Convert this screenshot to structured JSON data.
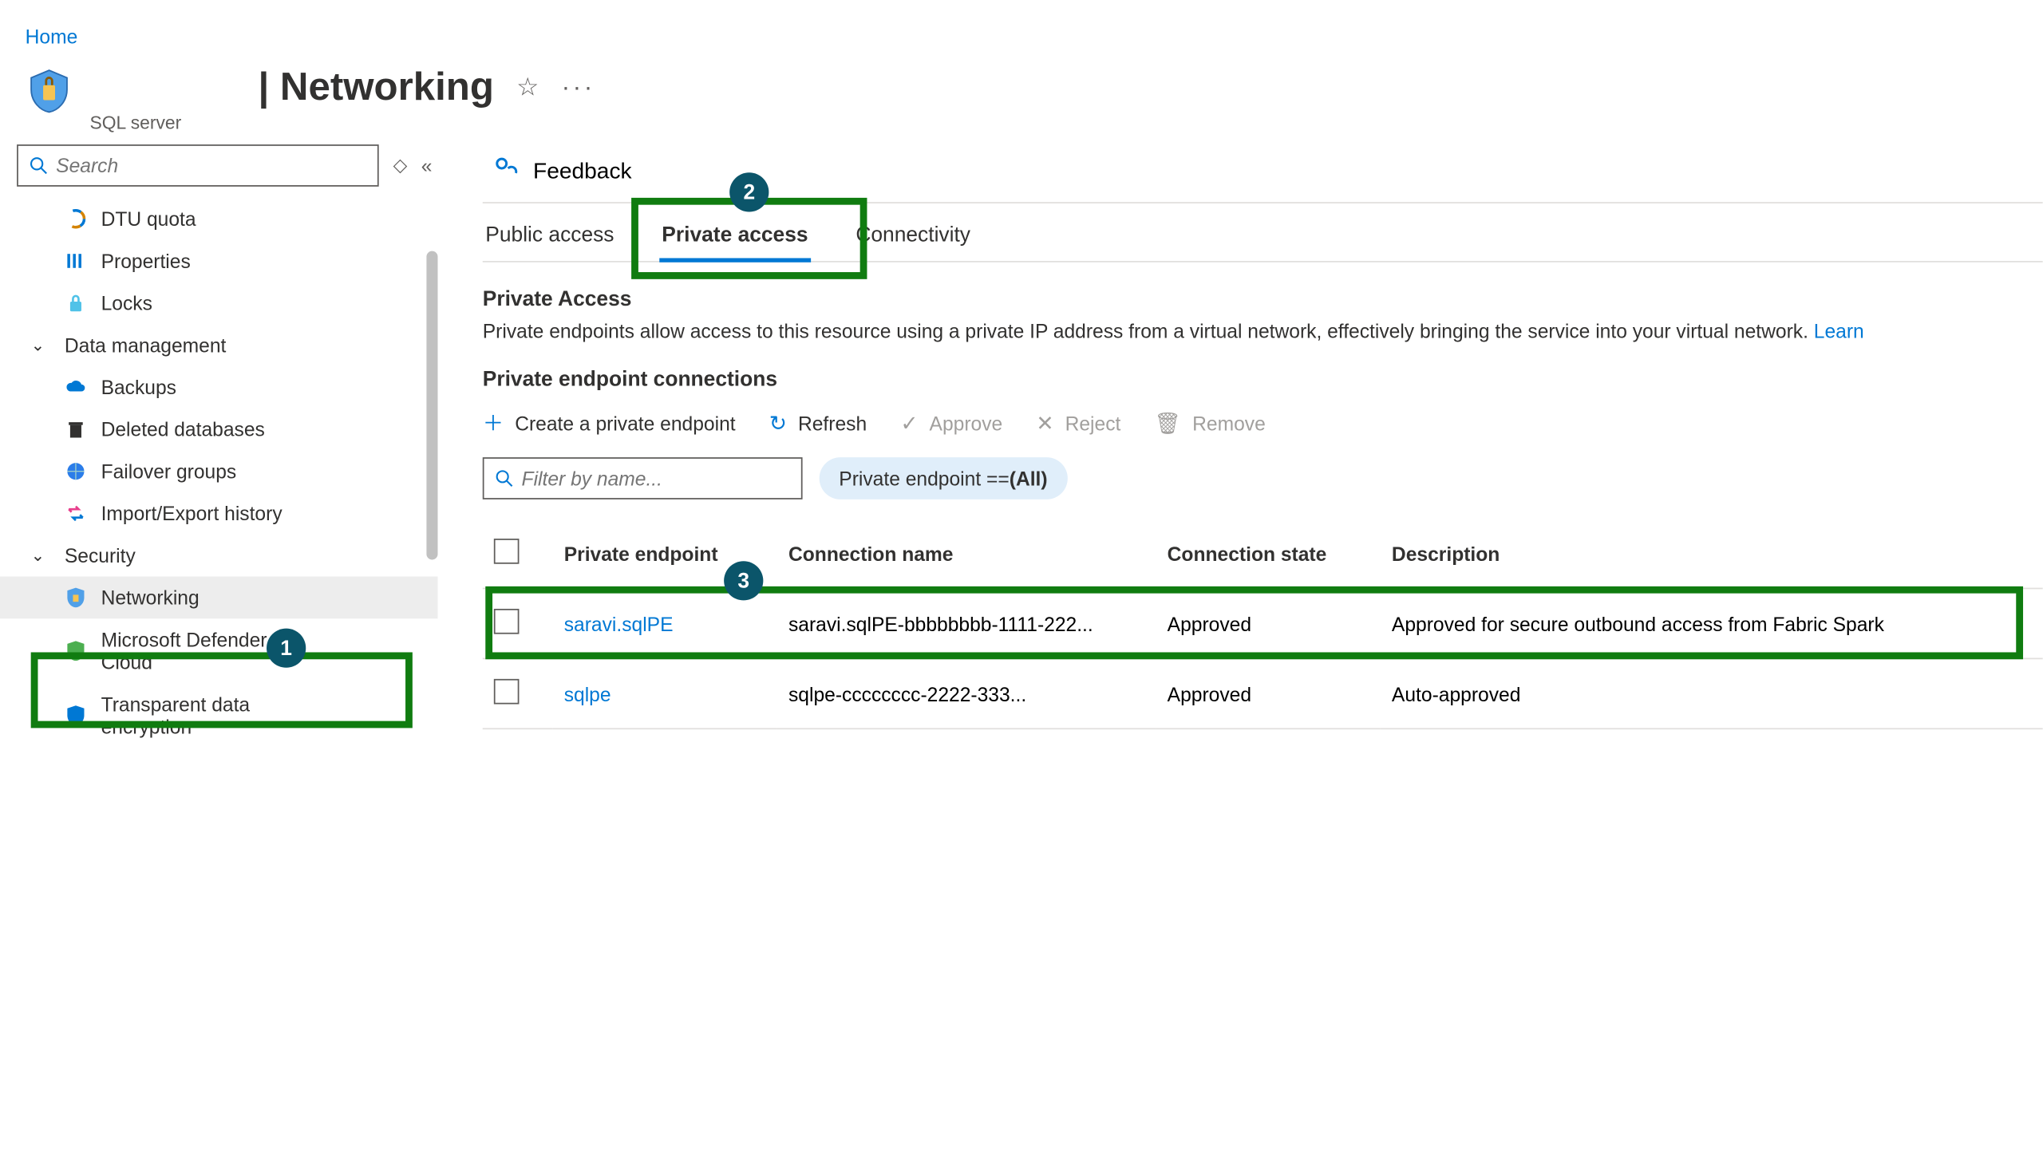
{
  "breadcrumb": {
    "home": "Home"
  },
  "header": {
    "title": "| Networking",
    "subtitle": "SQL server"
  },
  "sidebar": {
    "search_placeholder": "Search",
    "items": [
      {
        "label": "DTU quota",
        "icon": "gauge"
      },
      {
        "label": "Properties",
        "icon": "properties"
      },
      {
        "label": "Locks",
        "icon": "lock"
      }
    ],
    "sections": [
      {
        "label": "Data management",
        "items": [
          {
            "label": "Backups",
            "icon": "cloud"
          },
          {
            "label": "Deleted databases",
            "icon": "trash"
          },
          {
            "label": "Failover groups",
            "icon": "globe"
          },
          {
            "label": "Import/Export history",
            "icon": "importexport"
          }
        ]
      },
      {
        "label": "Security",
        "items": [
          {
            "label": "Networking",
            "icon": "shield",
            "selected": true
          },
          {
            "label": "Microsoft Defender for Cloud",
            "icon": "defender"
          },
          {
            "label": "Transparent data encryption",
            "icon": "encryption"
          }
        ]
      }
    ]
  },
  "main": {
    "feedback_label": "Feedback",
    "tabs": [
      {
        "label": "Public access"
      },
      {
        "label": "Private access",
        "active": true
      },
      {
        "label": "Connectivity"
      }
    ],
    "section_title": "Private Access",
    "section_desc": "Private endpoints allow access to this resource using a private IP address from a virtual network, effectively bringing the service into your virtual network.",
    "learn_link": "Learn",
    "connections_title": "Private endpoint connections",
    "toolbar": {
      "create": "Create a private endpoint",
      "refresh": "Refresh",
      "approve": "Approve",
      "reject": "Reject",
      "remove": "Remove"
    },
    "filter_placeholder": "Filter by name...",
    "filter_pill_prefix": "Private endpoint == ",
    "filter_pill_value": "(All)",
    "table": {
      "headers": {
        "pe": "Private endpoint",
        "conn": "Connection name",
        "state": "Connection state",
        "desc": "Description"
      },
      "rows": [
        {
          "pe": "saravi.sqlPE",
          "conn": "saravi.sqlPE-bbbbbbbb-1111-222...",
          "state": "Approved",
          "desc": "Approved for secure outbound access from Fabric Spark"
        },
        {
          "pe": "sqlpe",
          "conn": "sqlpe-cccccccc-2222-333...",
          "state": "Approved",
          "desc": "Auto-approved"
        }
      ]
    }
  },
  "callouts": {
    "c1": "1",
    "c2": "2",
    "c3": "3"
  }
}
